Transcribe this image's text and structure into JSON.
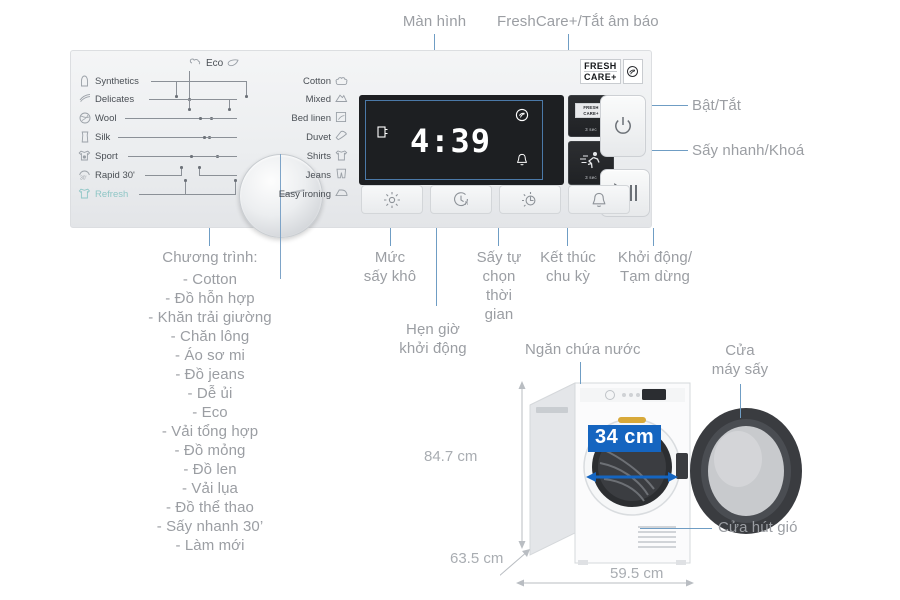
{
  "annotations": {
    "display": "Màn hình",
    "freshcare": "FreshCare+/Tắt âm báo",
    "power": "Bật/Tắt",
    "quickdry": "Sấy nhanh/Khoá",
    "dry_level": "Mức\nsấy khô",
    "delay_start": "Hẹn giờ\nkhởi động",
    "auto_time": "Sấy tự\nchọn\nthời\ngian",
    "end_cycle": "Kết thúc\nchu kỳ",
    "start_pause": "Khởi động/\nTạm dừng",
    "water_tank": "Ngăn chứa nước",
    "dryer_door": "Cửa\nmáy sấy",
    "air_intake": "Cửa hút gió"
  },
  "program_list": {
    "title": "Chương trình:",
    "items": [
      "- Cotton",
      "- Đồ hỗn hợp",
      "- Khăn trải giường",
      "- Chăn lông",
      "- Áo sơ mi",
      "- Đồ jeans",
      "- Dễ ủi",
      "- Eco",
      "- Vải tổng hợp",
      "- Đồ mỏng",
      "- Đồ len",
      "- Vải lụa",
      "- Đồ thể thao",
      "- Sấy nhanh 30’",
      "- Làm mới"
    ]
  },
  "panel": {
    "eco_label": "Eco",
    "programs_left": [
      "Synthetics",
      "Delicates",
      "Wool",
      "Silk",
      "Sport",
      "Rapid 30'",
      "Refresh"
    ],
    "programs_right": [
      "Cotton",
      "Mixed",
      "Bed linen",
      "Duvet",
      "Shirts",
      "Jeans",
      "Easy ironing"
    ],
    "display_value": "4:39",
    "freshcare_key_badge_top": "FRESH",
    "freshcare_key_badge_bottom": "CARE+",
    "freshcare_key_sub": "3 sec",
    "quickdry_key_sub": "3 sec",
    "logo_top": "FRESH",
    "logo_bottom": "CARE+"
  },
  "dimensions": {
    "height": "84.7 cm",
    "depth": "63.5  cm",
    "width": "59.5 cm",
    "door_opening": "34 cm"
  },
  "colors": {
    "accent": "#6f9dc4",
    "badge_blue": "#1565c0",
    "anno_gray": "#9b9ea3",
    "panel_bg": "#eceef0",
    "display_bg": "#1d1f22"
  }
}
